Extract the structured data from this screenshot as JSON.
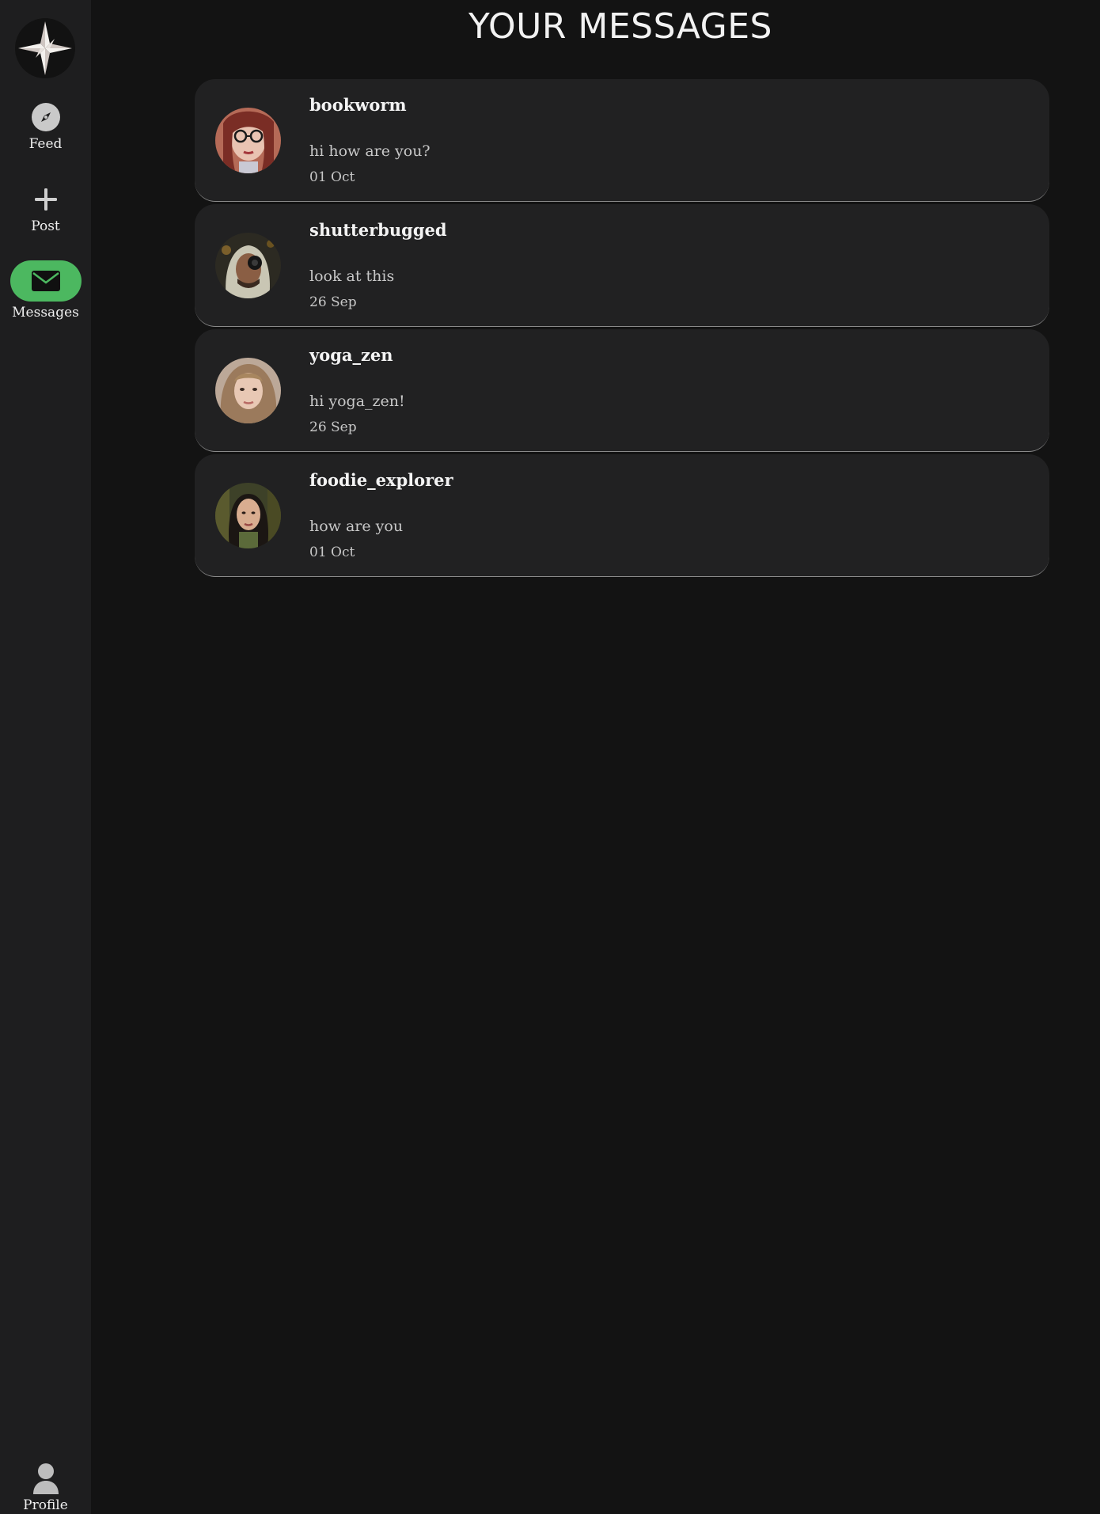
{
  "sidebar": {
    "logo_icon": "compass-star-icon",
    "items": [
      {
        "label": "Feed",
        "icon": "compass-icon"
      },
      {
        "label": "Post",
        "icon": "plus-icon"
      },
      {
        "label": "Messages",
        "icon": "envelope-icon",
        "active": true
      },
      {
        "label": "Profile",
        "icon": "user-icon"
      }
    ]
  },
  "page": {
    "title": "YOUR MESSAGES"
  },
  "threads": [
    {
      "username": "bookworm",
      "preview": "hi how are you?",
      "date": "01 Oct"
    },
    {
      "username": "shutterbugged",
      "preview": "look at this",
      "date": "26 Sep"
    },
    {
      "username": "yoga_zen",
      "preview": "hi yoga_zen!",
      "date": "26 Sep"
    },
    {
      "username": "foodie_explorer",
      "preview": "how are you",
      "date": "01 Oct"
    }
  ],
  "colors": {
    "background": "#131313",
    "sidebar": "#1e1e1f",
    "card": "#212122",
    "accent": "#4cb860",
    "text": "#f2f2f2",
    "muted_text": "#c8c8c8"
  }
}
